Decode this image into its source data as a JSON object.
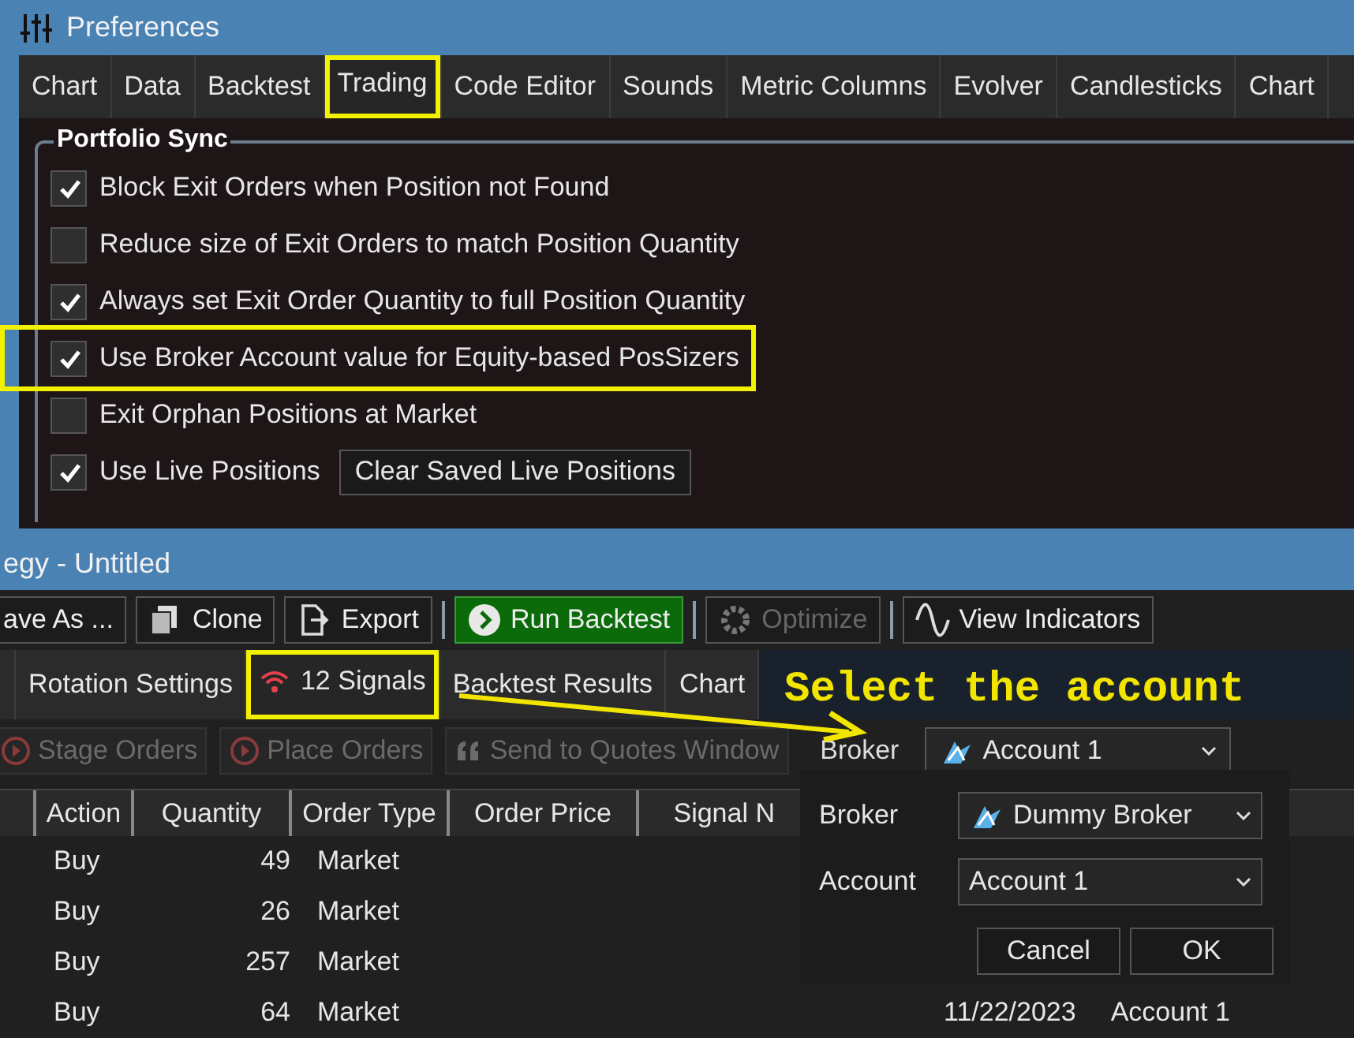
{
  "preferences_window": {
    "title": "Preferences",
    "tabs": [
      {
        "label": "Chart",
        "selected": false,
        "highlighted": false
      },
      {
        "label": "Data",
        "selected": false,
        "highlighted": false
      },
      {
        "label": "Backtest",
        "selected": false,
        "highlighted": false
      },
      {
        "label": "Trading",
        "selected": true,
        "highlighted": true
      },
      {
        "label": "Code Editor",
        "selected": false,
        "highlighted": false
      },
      {
        "label": "Sounds",
        "selected": false,
        "highlighted": false
      },
      {
        "label": "Metric Columns",
        "selected": false,
        "highlighted": false
      },
      {
        "label": "Evolver",
        "selected": false,
        "highlighted": false
      },
      {
        "label": "Candlesticks",
        "selected": false,
        "highlighted": false
      },
      {
        "label": "Chart",
        "selected": false,
        "highlighted": false
      }
    ],
    "group_title": "Portfolio Sync",
    "options": [
      {
        "label": "Block Exit Orders when Position not Found",
        "checked": true,
        "highlighted": false
      },
      {
        "label": "Reduce size of Exit Orders to match Position Quantity",
        "checked": false,
        "highlighted": false
      },
      {
        "label": "Always set Exit Order Quantity to full Position Quantity",
        "checked": true,
        "highlighted": false
      },
      {
        "label": "Use Broker Account value for Equity-based PosSizers",
        "checked": true,
        "highlighted": true
      },
      {
        "label": "Exit Orphan Positions at Market",
        "checked": false,
        "highlighted": false
      },
      {
        "label": "Use Live Positions",
        "checked": true,
        "highlighted": false
      }
    ],
    "clear_button": "Clear Saved Live Positions"
  },
  "strategy_window": {
    "title": "egy - Untitled",
    "toolbar": [
      {
        "label": "ave As ...",
        "kind": "plain",
        "disabled": false
      },
      {
        "label": "Clone",
        "kind": "clone",
        "disabled": false
      },
      {
        "label": "Export",
        "kind": "export",
        "disabled": false
      },
      {
        "label": "Run Backtest",
        "kind": "run",
        "disabled": false
      },
      {
        "label": "Optimize",
        "kind": "optimize",
        "disabled": true
      },
      {
        "label": "View Indicators",
        "kind": "indicators",
        "disabled": false
      }
    ],
    "tabs": [
      {
        "label": "Rotation Settings",
        "selected": false,
        "highlighted": false,
        "kind": "plain"
      },
      {
        "label": "12 Signals",
        "selected": true,
        "highlighted": true,
        "kind": "signals"
      },
      {
        "label": "Backtest Results",
        "selected": false,
        "highlighted": false,
        "kind": "plain"
      },
      {
        "label": "Chart",
        "selected": false,
        "highlighted": false,
        "kind": "plain"
      }
    ],
    "annotation": "Select the account",
    "signal_buttons": [
      {
        "label": "Stage Orders",
        "kind": "play",
        "disabled": true
      },
      {
        "label": "Place Orders",
        "kind": "play",
        "disabled": true
      },
      {
        "label": "Send to Quotes Window",
        "kind": "quote",
        "disabled": true
      }
    ],
    "broker_label": "Broker",
    "account_dropdown": "Account 1",
    "table": {
      "columns": [
        "Action",
        "Quantity",
        "Order Type",
        "Order Price",
        "Signal N"
      ],
      "rows": [
        {
          "action": "Buy",
          "quantity": "49",
          "order_type": "Market"
        },
        {
          "action": "Buy",
          "quantity": "26",
          "order_type": "Market"
        },
        {
          "action": "Buy",
          "quantity": "257",
          "order_type": "Market"
        },
        {
          "action": "Buy",
          "quantity": "64",
          "order_type": "Market",
          "column_7": "11/22/2023",
          "column_8": "Account 1"
        }
      ]
    }
  },
  "account_popup": {
    "fields": [
      {
        "label": "Broker",
        "value": "Dummy Broker",
        "kind": "broker"
      },
      {
        "label": "Account",
        "value": "Account 1",
        "kind": "account"
      }
    ],
    "buttons": [
      "Cancel",
      "OK"
    ]
  }
}
